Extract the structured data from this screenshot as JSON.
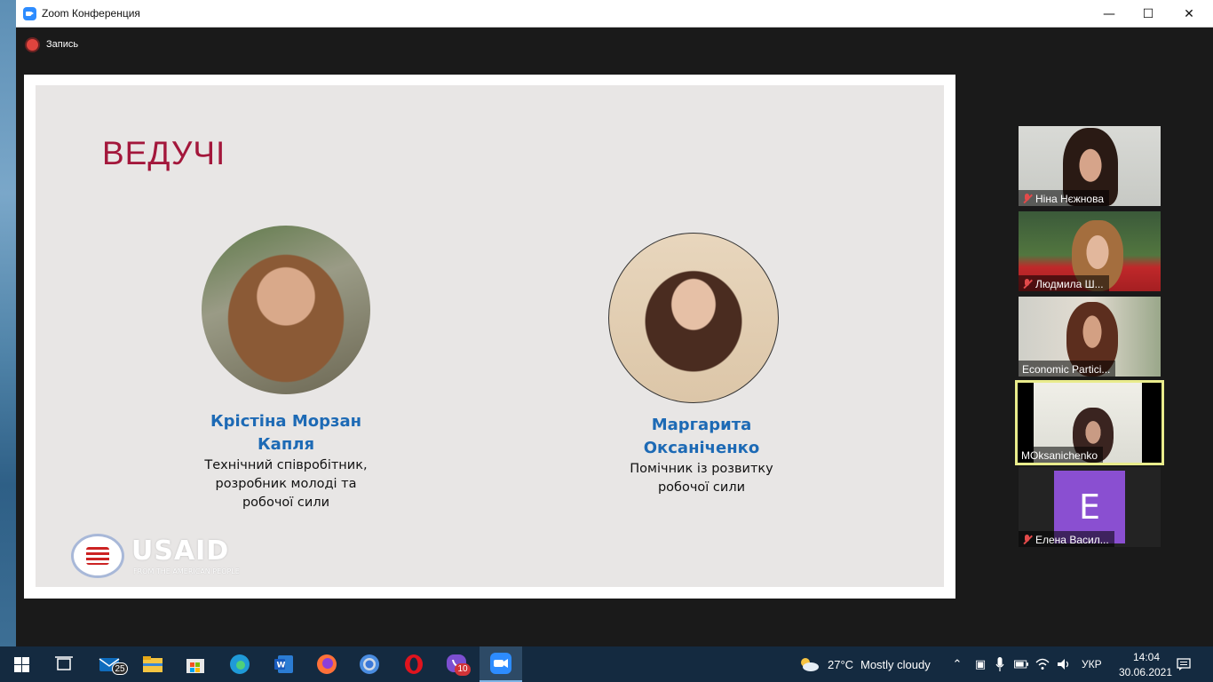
{
  "window": {
    "title": "Zoom Конференция",
    "minimize_glyph": "—",
    "maximize_glyph": "☐",
    "close_glyph": "✕"
  },
  "recording": {
    "label": "Запись",
    "color": "#e0443e"
  },
  "slide": {
    "title": "ВЕДУЧІ",
    "title_color": "#a3173b",
    "presenters": [
      {
        "name_line1": "Крістіна Морзан",
        "name_line2": "Капля",
        "role_lines": [
          "Технічний співробітник,",
          "розробник молоді та",
          "робочої сили"
        ]
      },
      {
        "name_line1": "Маргарита",
        "name_line2": "Оксаніченко",
        "role_lines": [
          "Помічник із розвитку",
          "робочої сили"
        ]
      }
    ],
    "name_color": "#1d6ab5",
    "logo": {
      "word": "USAID",
      "tagline": "FROM THE AMERICAN PEOPLE"
    }
  },
  "participants": [
    {
      "name": "Ніна Нєжнова",
      "muted": true
    },
    {
      "name": "Людмила Ш...",
      "muted": true
    },
    {
      "name": "Economic Partici...",
      "muted": false
    },
    {
      "name": "MOksanichenko",
      "muted": false,
      "active_speaker": true
    },
    {
      "name": "Елена Васил...",
      "muted": true,
      "avatar_letter": "E",
      "avatar_color": "#8a4fd1"
    }
  ],
  "taskbar": {
    "mail_badge": "25",
    "viber_badge": "10",
    "weather": {
      "temp": "27°C",
      "condition": "Mostly cloudy"
    },
    "language": "УКР",
    "time": "14:04",
    "date": "30.06.2021",
    "icons": [
      "windows-start-icon",
      "task-view-icon",
      "mail-icon",
      "file-explorer-icon",
      "store-icon",
      "edge-icon",
      "word-icon",
      "firefox-icon",
      "chrome-icon",
      "opera-icon",
      "viber-icon",
      "zoom-icon"
    ]
  }
}
